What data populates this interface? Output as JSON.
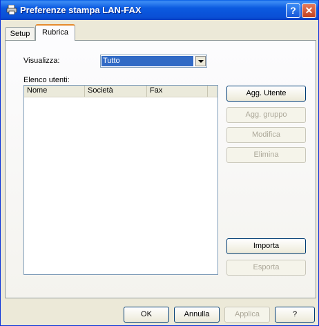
{
  "window": {
    "title": "Preferenze stampa LAN-FAX",
    "help_glyph": "?",
    "close_glyph": "✕"
  },
  "tabs": [
    {
      "label": "Setup"
    },
    {
      "label": "Rubrica"
    }
  ],
  "rubrica": {
    "view_label": "Visualizza:",
    "view_value": "Tutto",
    "users_label": "Elenco utenti:",
    "columns": [
      "Nome",
      "Società",
      "Fax"
    ],
    "buttons": {
      "add_user": "Agg. Utente",
      "add_group": "Agg. gruppo",
      "edit": "Modifica",
      "delete": "Elimina",
      "import": "Importa",
      "export": "Esporta"
    }
  },
  "footer": {
    "ok": "OK",
    "cancel": "Annulla",
    "apply": "Applica",
    "help": "?"
  },
  "colors": {
    "titlebar": "#0a4fd6",
    "selection": "#316ac5",
    "face": "#ece9d8"
  }
}
